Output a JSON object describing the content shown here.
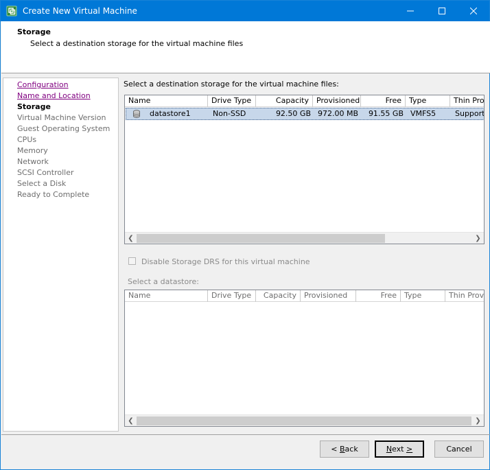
{
  "window": {
    "title": "Create New Virtual Machine",
    "icon": "vsphere-icon",
    "controls": [
      "minimize-icon",
      "maximize-icon",
      "close-icon"
    ]
  },
  "header": {
    "title": "Storage",
    "subtitle": "Select a destination storage for the virtual machine files"
  },
  "nav": {
    "items": [
      {
        "label": "Configuration",
        "state": "visited"
      },
      {
        "label": "Name and Location",
        "state": "visited"
      },
      {
        "label": "Storage",
        "state": "current"
      },
      {
        "label": "Virtual Machine Version",
        "state": "pending"
      },
      {
        "label": "Guest Operating System",
        "state": "pending"
      },
      {
        "label": "CPUs",
        "state": "pending"
      },
      {
        "label": "Memory",
        "state": "pending"
      },
      {
        "label": "Network",
        "state": "pending"
      },
      {
        "label": "SCSI Controller",
        "state": "pending"
      },
      {
        "label": "Select a Disk",
        "state": "pending"
      },
      {
        "label": "Ready to Complete",
        "state": "pending"
      }
    ]
  },
  "main": {
    "label": "Select a destination storage for the virtual machine files:",
    "datastore_table": {
      "columns": [
        "Name",
        "Drive Type",
        "Capacity",
        "Provisioned",
        "Free",
        "Type",
        "Thin Prov"
      ],
      "rows": [
        {
          "name": "datastore1",
          "drive_type": "Non-SSD",
          "capacity": "92.50 GB",
          "provisioned": "972.00 MB",
          "free": "91.55 GB",
          "type": "VMFS5",
          "thin": "Supporte",
          "icon": "database-icon",
          "selected": true
        }
      ]
    },
    "disable_drs_label": "Disable Storage DRS for this virtual machine",
    "select_datastore_label": "Select a datastore:",
    "cluster_table": {
      "columns": [
        "Name",
        "Drive Type",
        "Capacity",
        "Provisioned",
        "Free",
        "Type",
        "Thin Provi"
      ],
      "rows": []
    }
  },
  "footer": {
    "back_label": "Back",
    "back_mnemonic": "B",
    "next_label": "Next",
    "next_mnemonic": "N",
    "cancel_label": "Cancel"
  },
  "colors": {
    "titlebar": "#0078d7",
    "selected_row": "#c7d7ea",
    "visited_link": "#800080"
  }
}
